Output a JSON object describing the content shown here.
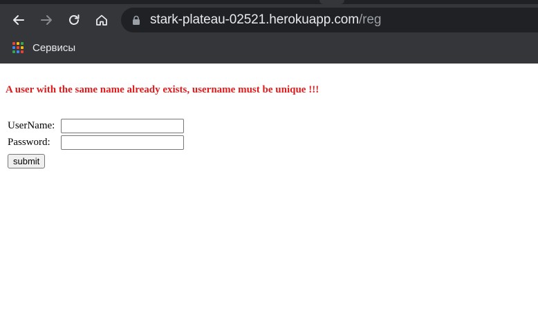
{
  "browser": {
    "url_host": "stark-plateau-02521.herokuapp.com",
    "url_path": "/reg",
    "bookmark_label": "Сервисы",
    "colors": {
      "chrome": "#35363a",
      "omnibox": "#202124"
    }
  },
  "page": {
    "error_message": "A user with the same name already exists, username must be unique !!!",
    "error_color": "#e01b1b",
    "form": {
      "username_label": "UserName:",
      "username_value": "",
      "password_label": "Password:",
      "password_value": "",
      "submit_label": "submit"
    }
  }
}
